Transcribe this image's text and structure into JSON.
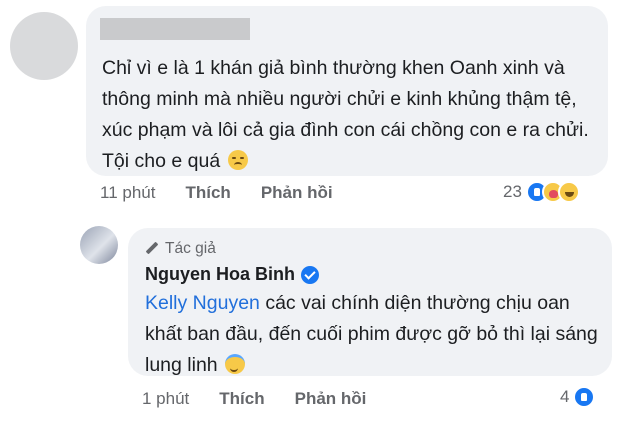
{
  "comment": {
    "author_redacted": true,
    "text": "Chỉ vì e là 1 khán giả bình thường khen Oanh xinh và thông minh mà nhiều người chửi e kinh khủng thậm tệ, xúc phạm và lôi cả gia đình con cái chồng con e ra chửi. Tội cho e quá",
    "emoji": "sad-face-emoji",
    "time": "11 phút",
    "like_label": "Thích",
    "reply_label": "Phản hồi",
    "reaction_count": "23",
    "reactions": [
      "like-icon",
      "care-icon",
      "haha-icon"
    ]
  },
  "reply": {
    "badge": "Tác giả",
    "author": "Nguyen Hoa Binh",
    "verified": true,
    "mention": "Kelly Nguyen",
    "text": " các vai chính diện thường chịu oan khất ban đầu, đến cuối phim được gỡ bỏ thì lại sáng lung linh",
    "emoji": "halo-face-emoji",
    "time": "1 phút",
    "like_label": "Thích",
    "reply_label": "Phản hồi",
    "reaction_count": "4",
    "reactions": [
      "like-icon"
    ]
  },
  "colors": {
    "bubble": "#f0f2f5",
    "meta_text": "#65676b",
    "mention": "#216fdb",
    "like_blue": "#1877f2"
  }
}
